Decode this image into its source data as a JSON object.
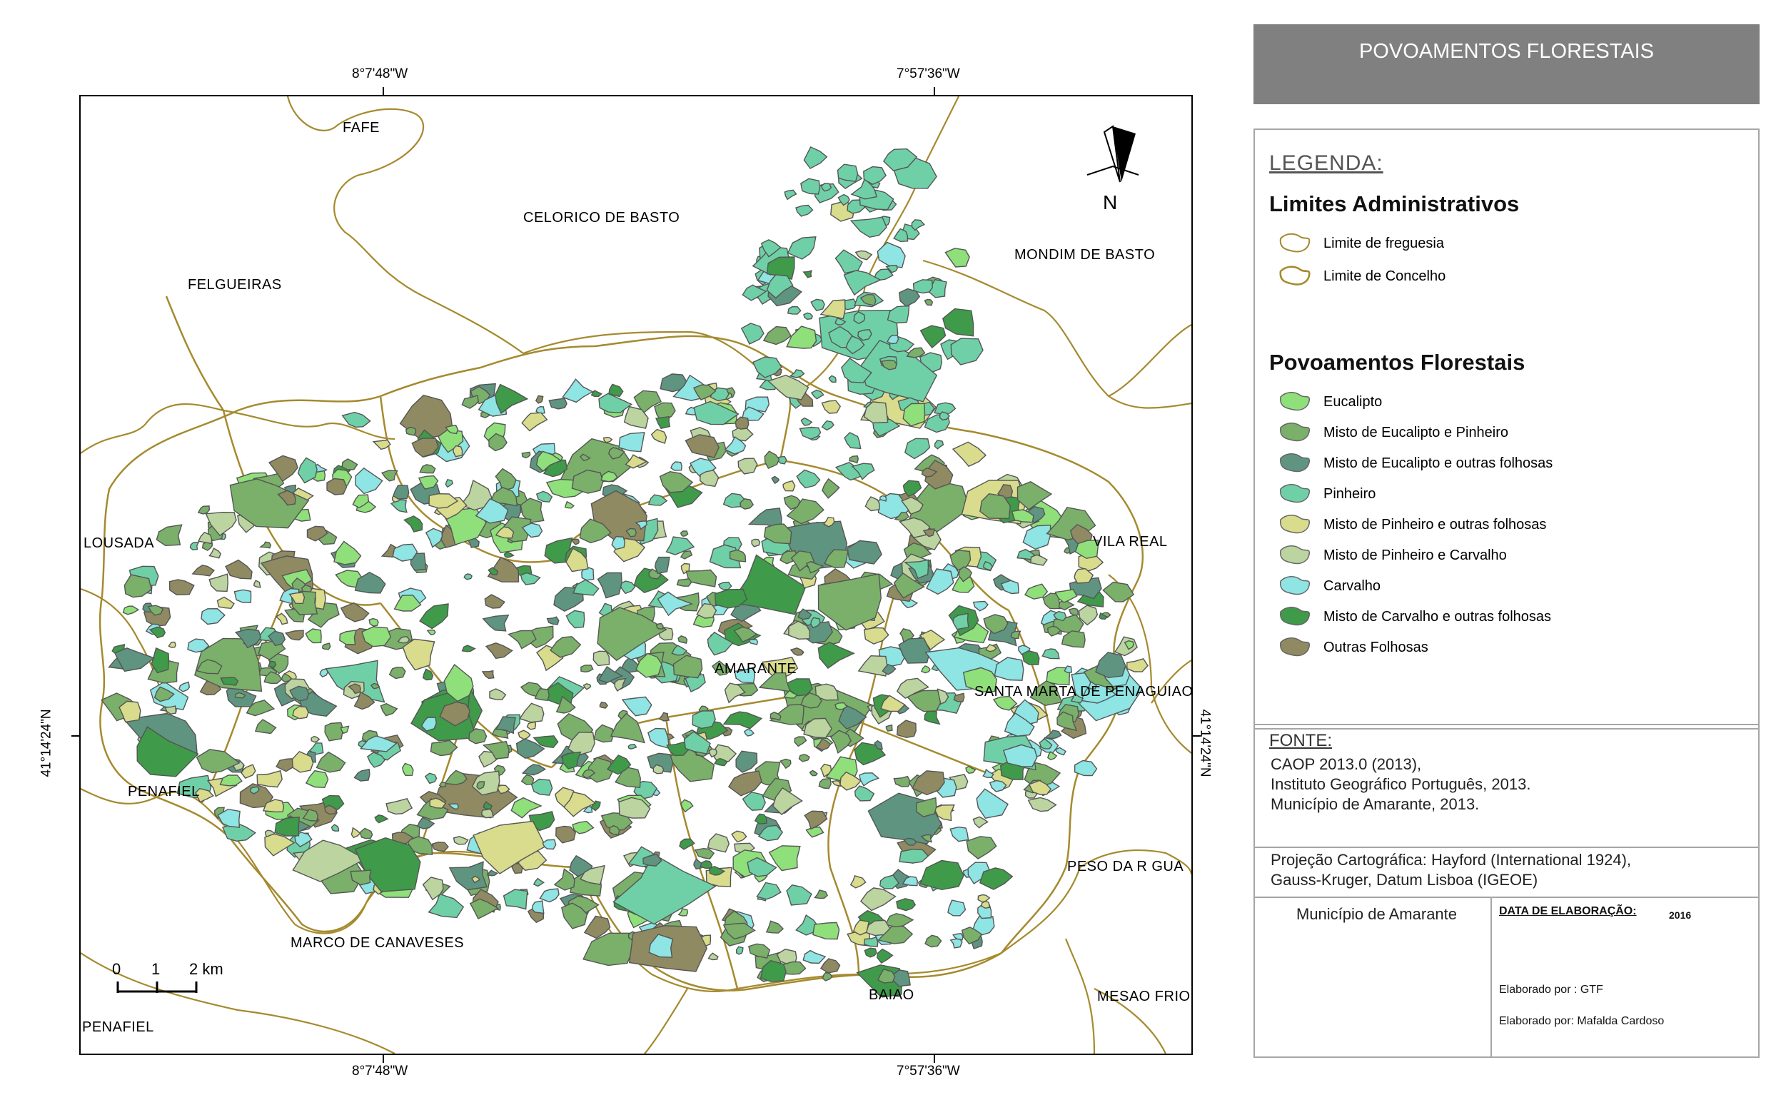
{
  "map": {
    "coords": {
      "top_left": "8°7'48\"W",
      "top_right": "7°57'36\"W",
      "bottom_left": "8°7'48\"W",
      "bottom_right": "7°57'36\"W",
      "left_lat": "41°14'24\"N",
      "right_lat": "41°14'24\"N"
    },
    "north_label": "N",
    "places": {
      "fafe": "FAFE",
      "celorico": "CELORICO DE BASTO",
      "mondim": "MONDIM DE BASTO",
      "felgueiras": "FELGUEIRAS",
      "lousada": "LOUSADA",
      "vila_real": "VILA REAL",
      "amarante": "AMARANTE",
      "santa_marta": "SANTA MARTA DE PENAGUIAO",
      "penafiel": "PENAFIEL",
      "peso_regua": "PESO DA R  GUA",
      "marco": "MARCO DE CANAVESES",
      "baiao": "BAIAO",
      "mesao_frio": "MESAO FRIO",
      "penafiel2": "PENAFIEL"
    },
    "scale": {
      "l0": "0",
      "l1": "1",
      "l2": "2 km"
    },
    "colors": {
      "eucalipto": "#8fe07a",
      "misto_euc_pin": "#7ab06a",
      "misto_euc_folh": "#5f9480",
      "pinheiro": "#6fd0a8",
      "misto_pin_folh": "#d8dc8c",
      "misto_pin_carv": "#bcd4a0",
      "carvalho": "#8fe4e4",
      "misto_carv_folh": "#3f9a4a",
      "outras_folhosas": "#8f8a62",
      "boundary": "#a58a2e",
      "patch_outline": "#555555"
    }
  },
  "panel": {
    "title": "POVOAMENTOS FLORESTAIS",
    "legend_heading": "LEGENDA:",
    "admin_title": "Limites Administrativos",
    "admin_items": [
      "Limite de freguesia",
      "Limite de Concelho"
    ],
    "forest_title": "Povoamentos Florestais",
    "forest_items": [
      {
        "label": "Eucalipto",
        "color": "#8fe07a"
      },
      {
        "label": "Misto de Eucalipto e Pinheiro",
        "color": "#7ab06a"
      },
      {
        "label": "Misto de Eucalipto e outras folhosas",
        "color": "#5f9480"
      },
      {
        "label": "Pinheiro",
        "color": "#6fd0a8"
      },
      {
        "label": "Misto de Pinheiro e outras folhosas",
        "color": "#d8dc8c"
      },
      {
        "label": "Misto de  Pinheiro e Carvalho",
        "color": "#bcd4a0"
      },
      {
        "label": "Carvalho",
        "color": "#8fe4e4"
      },
      {
        "label": "Misto de Carvalho e outras folhosas",
        "color": "#3f9a4a"
      },
      {
        "label": "Outras Folhosas",
        "color": "#8f8a62"
      }
    ],
    "fonte_heading": "FONTE:",
    "fonte_lines": [
      "CAOP 2013.0 (2013),",
      "Instituto Geográfico Português, 2013.",
      "Município de Amarante, 2013."
    ],
    "projecao_lines": [
      "Projeção Cartográfica: Hayford (International 1924),",
      "Gauss-Kruger, Datum Lisboa (IGEOE)"
    ],
    "municipio": "Município de Amarante",
    "data_label": "DATA DE ELABORAÇÃO:",
    "data_value": "2016",
    "elaborado1": "Elaborado por : GTF",
    "elaborado2": "Elaborado por: Mafalda Cardoso"
  }
}
